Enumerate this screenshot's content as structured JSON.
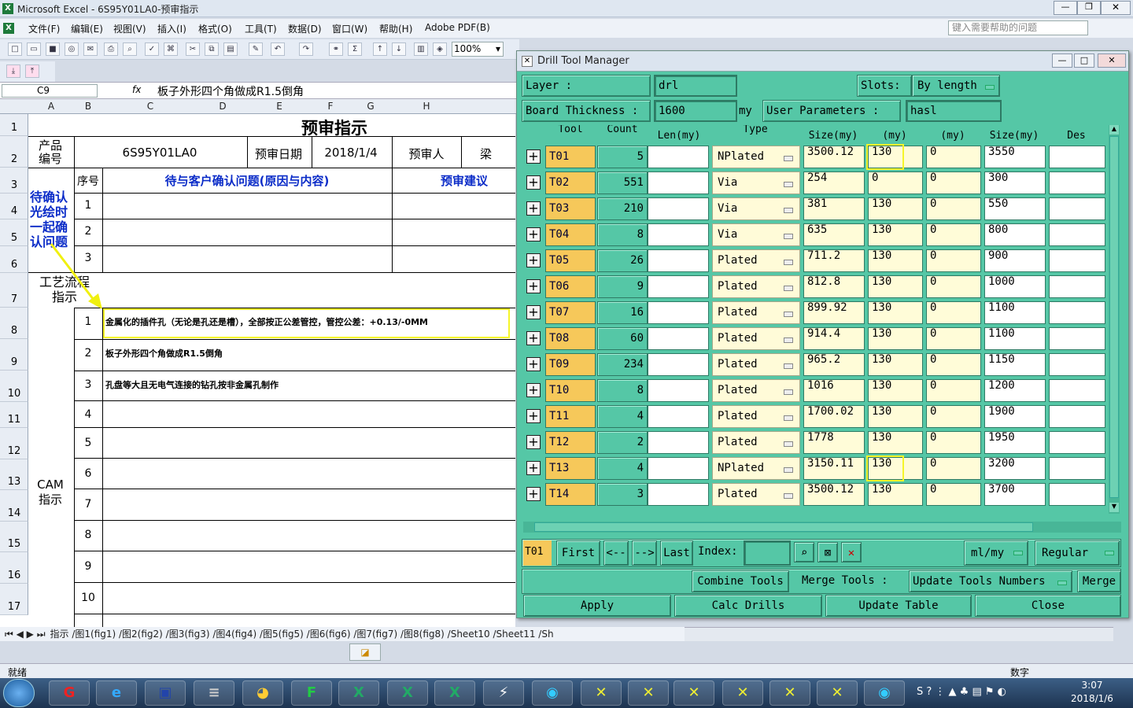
{
  "excel": {
    "title": "Microsoft Excel - 6S95Y01LA0-预审指示",
    "menu": [
      "文件(F)",
      "编辑(E)",
      "视图(V)",
      "插入(I)",
      "格式(O)",
      "工具(T)",
      "数据(D)",
      "窗口(W)",
      "帮助(H)",
      "Adobe PDF(B)"
    ],
    "help_placeholder": "键入需要帮助的问题",
    "zoom": "100%",
    "name_box": "C9",
    "fx": "fx",
    "formula": "板子外形四个角做成R1.5倒角",
    "columns": [
      "A",
      "B",
      "C",
      "D",
      "E",
      "F",
      "G",
      "H"
    ],
    "rows": [
      "1",
      "2",
      "3",
      "4",
      "5",
      "6",
      "7",
      "8",
      "9",
      "10",
      "11",
      "12",
      "13",
      "14",
      "15",
      "16",
      "17"
    ],
    "sheet_title": "预审指示",
    "product_no_label": "产品\n编号",
    "product_no": "6S95Y01LA0",
    "review_date_label": "预审日期",
    "review_date": "2018/1/4",
    "reviewer_label": "预审人",
    "reviewer": "梁",
    "seq_label": "序号",
    "issue_header": "待与客户确认问题(原因与内容)",
    "advice_header": "预审建议",
    "pending_note": "待确认光绘时一起确认问题",
    "process_label": "工艺流程指示",
    "cam_label": "CAM指示",
    "issue_rows": [
      "1",
      "2",
      "3"
    ],
    "cam_rows": [
      {
        "n": "1",
        "text": "金属化的插件孔（无论是孔还是槽），全部按正公差管控，管控公差：+0.13/-0MM"
      },
      {
        "n": "2",
        "text": "板子外形四个角做成R1.5倒角"
      },
      {
        "n": "3",
        "text": "孔盘等大且无电气连接的钻孔按非金属孔制作"
      },
      {
        "n": "4",
        "text": ""
      },
      {
        "n": "5",
        "text": ""
      },
      {
        "n": "6",
        "text": ""
      },
      {
        "n": "7",
        "text": ""
      },
      {
        "n": "8",
        "text": ""
      },
      {
        "n": "9",
        "text": ""
      },
      {
        "n": "10",
        "text": ""
      }
    ],
    "sheet_tabs": "指示 /图1(fig1) /图2(fig2) /图3(fig3) /图4(fig4) /图5(fig5) /图6(fig6) /图7(fig7) /图8(fig8) /Sheet10 /Sheet11 /Sh",
    "status": "就绪",
    "status_right": "数字"
  },
  "dtm": {
    "title": "Drill Tool Manager",
    "layer_label": "Layer          :",
    "layer": "drl",
    "slots_label": "Slots:",
    "slots_value": "By length",
    "board_label": "Board Thickness :",
    "board_value": "1600",
    "board_unit": "my",
    "user_params_label": "User Parameters :",
    "user_params_value": "hasl",
    "headers": [
      "Tool",
      "Count",
      "Len(my)",
      "Type",
      "Size(my)",
      "(my)",
      "(my)",
      "Size(my)",
      "Des"
    ],
    "rows": [
      {
        "tool": "T01",
        "count": "5",
        "type": "NPlated",
        "size": "3500.12",
        "tp": "130",
        "tm": "0",
        "fin": "3550"
      },
      {
        "tool": "T02",
        "count": "551",
        "type": "Via",
        "size": "254",
        "tp": "0",
        "tm": "0",
        "fin": "300"
      },
      {
        "tool": "T03",
        "count": "210",
        "type": "Via",
        "size": "381",
        "tp": "130",
        "tm": "0",
        "fin": "550"
      },
      {
        "tool": "T04",
        "count": "8",
        "type": "Via",
        "size": "635",
        "tp": "130",
        "tm": "0",
        "fin": "800"
      },
      {
        "tool": "T05",
        "count": "26",
        "type": "Plated",
        "size": "711.2",
        "tp": "130",
        "tm": "0",
        "fin": "900"
      },
      {
        "tool": "T06",
        "count": "9",
        "type": "Plated",
        "size": "812.8",
        "tp": "130",
        "tm": "0",
        "fin": "1000"
      },
      {
        "tool": "T07",
        "count": "16",
        "type": "Plated",
        "size": "899.92",
        "tp": "130",
        "tm": "0",
        "fin": "1100"
      },
      {
        "tool": "T08",
        "count": "60",
        "type": "Plated",
        "size": "914.4",
        "tp": "130",
        "tm": "0",
        "fin": "1100"
      },
      {
        "tool": "T09",
        "count": "234",
        "type": "Plated",
        "size": "965.2",
        "tp": "130",
        "tm": "0",
        "fin": "1150"
      },
      {
        "tool": "T10",
        "count": "8",
        "type": "Plated",
        "size": "1016",
        "tp": "130",
        "tm": "0",
        "fin": "1200"
      },
      {
        "tool": "T11",
        "count": "4",
        "type": "Plated",
        "size": "1700.02",
        "tp": "130",
        "tm": "0",
        "fin": "1900"
      },
      {
        "tool": "T12",
        "count": "2",
        "type": "Plated",
        "size": "1778",
        "tp": "130",
        "tm": "0",
        "fin": "1950"
      },
      {
        "tool": "T13",
        "count": "4",
        "type": "NPlated",
        "size": "3150.11",
        "tp": "130",
        "tm": "0",
        "fin": "3200"
      },
      {
        "tool": "T14",
        "count": "3",
        "type": "Plated",
        "size": "3500.12",
        "tp": "130",
        "tm": "0",
        "fin": "3700"
      }
    ],
    "current_tool": "T01",
    "first": "First",
    "prev": "<--",
    "next": "-->",
    "last": "Last",
    "index_label": "Index:",
    "units": "ml/my",
    "mode": "Regular",
    "combine": "Combine Tools",
    "merge_tools_label": "Merge Tools :",
    "update_numbers": "Update Tools Numbers",
    "merge": "Merge",
    "apply": "Apply",
    "calc": "Calc Drills",
    "update_table": "Update Table",
    "close": "Close"
  },
  "taskbar": {
    "time": "3:07",
    "date": "2018/1/6"
  },
  "colors": {
    "dialog_bg": "#55c7a6",
    "tool_cell": "#f6c85a",
    "highlight": "#f5f52a",
    "blue_text": "#0b2cc8"
  }
}
